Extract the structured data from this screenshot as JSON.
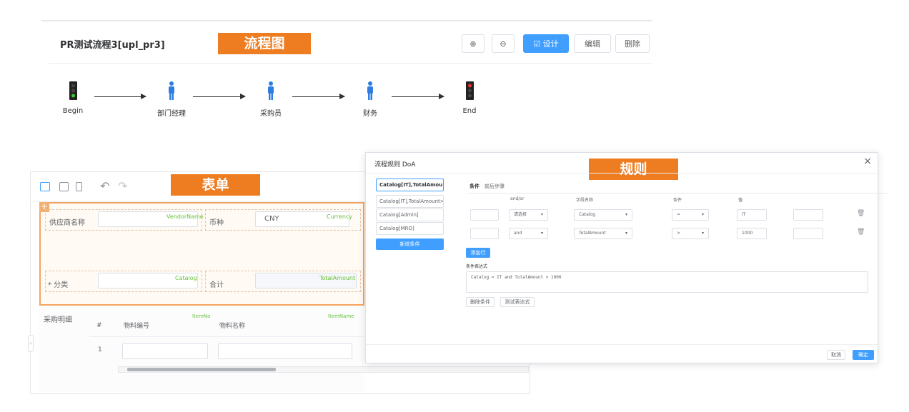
{
  "flow": {
    "title": "PR测试流程3[upl_pr3]",
    "section_tag": "流程图",
    "toolbar": {
      "zoom_in": "⊕",
      "zoom_out": "⊖",
      "design": "☑ 设计",
      "edit": "编辑",
      "delete": "删除"
    },
    "nodes": [
      {
        "label": "Begin",
        "icon": "traffic-light-green-icon"
      },
      {
        "label": "部门经理",
        "icon": "person-icon"
      },
      {
        "label": "采购员",
        "icon": "person-icon"
      },
      {
        "label": "财务",
        "icon": "person-icon"
      },
      {
        "label": "End",
        "icon": "traffic-light-red-icon"
      }
    ]
  },
  "form": {
    "section_tag": "表单",
    "toolbar": {
      "undo": "↶",
      "redo": "↷"
    },
    "fields": {
      "vendor_label": "供应商名称",
      "vendor_tag": "VendorName",
      "currency_label": "币种",
      "currency_value": "CNY",
      "currency_tag": "Currency",
      "category_label": "* 分类",
      "category_tag": "Catalog",
      "total_label": "合计",
      "total_tag": "TotalAmount"
    },
    "detail": {
      "label": "采购明细",
      "columns": {
        "index": "#",
        "item_no": "物料编号",
        "item_no_tag": "ItemNo",
        "item_name": "物料名称",
        "item_name_tag": "ItemName"
      },
      "row_index": "1"
    }
  },
  "rule_dialog": {
    "title": "流程规则 DoA",
    "section_tag": "规则",
    "close": "×",
    "conditions": [
      "Catalog[IT],TotalAmou",
      "Catalog[IT],TotalAmount>",
      "Catalog[Admin]",
      "Catalog[MRO]"
    ],
    "add_condition": "新增条件",
    "tabs": [
      "条件",
      "前后步骤"
    ],
    "headers": {
      "andor": "and/or",
      "field": "字段名称",
      "operator": "条件",
      "value": "值"
    },
    "rows": [
      {
        "andor": "请选择",
        "field": "Catalog",
        "operator": "=",
        "value": "IT"
      },
      {
        "andor": "and",
        "field": "TotalAmount",
        "operator": ">",
        "value": "1000"
      }
    ],
    "add_row": "添加行",
    "expression_label": "条件表达式",
    "expression": "Catalog = IT and TotalAmount > 1000",
    "delete_condition": "删除条件",
    "test_expression": "测试表达式",
    "cancel": "取消",
    "confirm": "确定"
  },
  "colors": {
    "accent": "#409eff",
    "tag": "#ee7d22",
    "field_tag": "#67c23a",
    "section_border": "#f4a460"
  }
}
